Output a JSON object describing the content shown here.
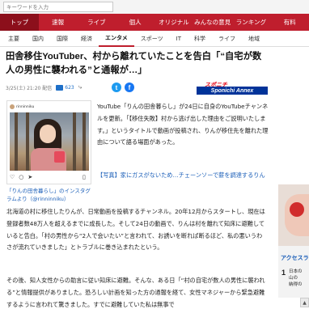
{
  "search": {
    "placeholder": "キーワードを入力"
  },
  "top_nav": [
    "トップ",
    "速報",
    "ライブ",
    "個人",
    "オリジナル",
    "みんなの意見",
    "ランキング",
    "有料"
  ],
  "sub_nav": [
    "主要",
    "国内",
    "国際",
    "経済",
    "エンタメ",
    "スポーツ",
    "IT",
    "科学",
    "ライフ",
    "地域"
  ],
  "article": {
    "title": "田舎移住YouTuber、村から離れていたことを告白「“自宅が数人の男性に襲われる”と通報が…」",
    "date": "3/25(土) 21:20 配信",
    "comment_count": "623",
    "source_logo_top": "スポニチ",
    "source_logo_bottom": "Sponichi Annex",
    "embed_account": "rinninniku",
    "embed_caption": "「りんの田舎暮らし」のインスタグラムより（@rinninniku）",
    "paragraph1": "YouTube「りんの田舎暮らし」が24日に自身のYouTubeチャンネルを更新。「【移住失敗】村から逃げ出した理由をご説明いたします。」というタイトルで動画が投稿され、りんが移住先を離れた理由について語る場面があった。",
    "link_text": "【写真】家にガスがないため…チェーンソーで薪を調達するりん",
    "paragraph2": "北海道の村に移住したりんが、日常動画を投稿するチャンネル。20年12月からスタートし、現在は登録者数48万人を超えるまでに成長した。そして24日の動画で、りんは村を離れて知床に避難していると告白。「村の男性から“2人で会いたい”と言われて、お誘いを断れば断るほど、私の悪いうわさが流れていきました」とトラブルに巻き込まれたという。",
    "paragraph3": "その後、知人女性からの助言に従い知床に避難。そんな、ある日「“村の自宅が数人の男性に襲われる”と情報提供がありました。恐ろしい計画を知った方の通報を経て、女性マネジャーから緊急避難するように言われて驚きました。すでに避難していた私は無事で"
  },
  "sidebar": {
    "ad_title": "アクセスランキング",
    "rank_number": "1",
    "rank_lines": [
      "日本の",
      "山の",
      "納得の"
    ]
  },
  "colors": {
    "brand_red": "#bf1e2d",
    "link_blue": "#1a5eb8"
  }
}
